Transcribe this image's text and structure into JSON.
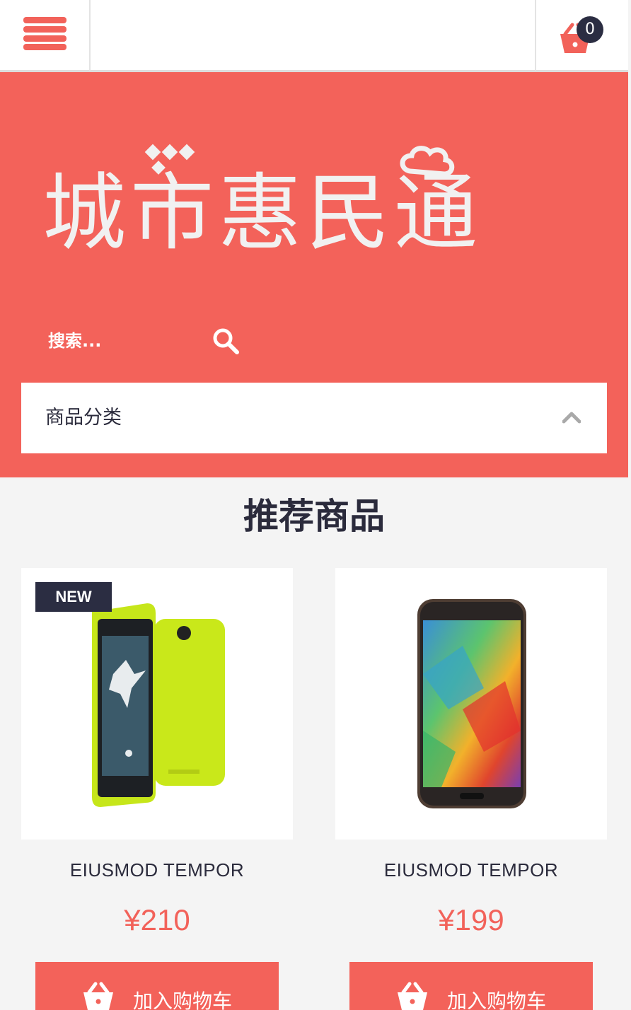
{
  "header": {
    "menu_icon": "hamburger-menu-icon",
    "cart_icon": "shopping-basket-icon",
    "cart_count": "0"
  },
  "hero": {
    "logo_text": "城市惠民通",
    "search": {
      "placeholder": "搜索...",
      "icon": "search-icon"
    },
    "category": {
      "label": "商品分类",
      "icon": "chevron-up-icon"
    }
  },
  "recommended": {
    "title": "推荐商品",
    "products": [
      {
        "badge": "NEW",
        "name": "EIUSMOD TEMPOR",
        "price": "¥210",
        "button": "加入购物车",
        "image": "lime-green-smartphone"
      },
      {
        "name": "EIUSMOD TEMPOR",
        "price": "¥199",
        "button": "加入购物车",
        "image": "samsung-galaxy-smartphone"
      }
    ]
  },
  "colors": {
    "accent": "#f3625a",
    "dark": "#2b2d42",
    "background": "#f4f4f4"
  }
}
